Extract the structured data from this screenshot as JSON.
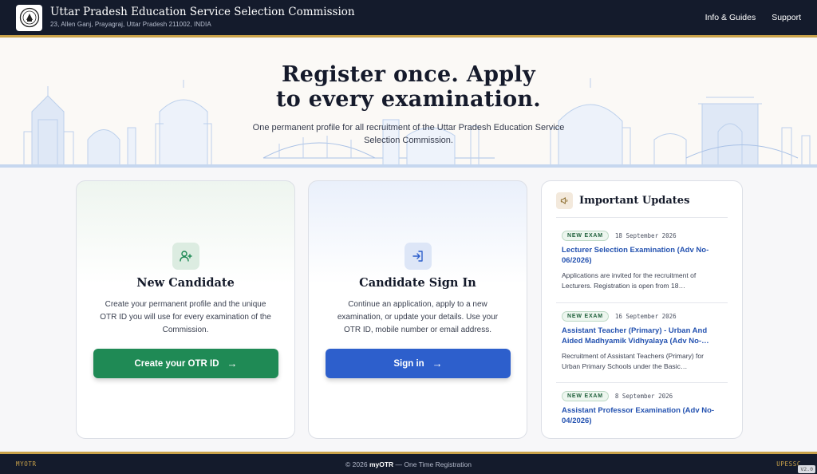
{
  "header": {
    "title": "Uttar Pradesh Education Service Selection Commission",
    "address": "23, Allen Ganj, Prayagraj, Uttar Pradesh 211002, INDIA",
    "nav": [
      "Info & Guides",
      "Support"
    ],
    "logo_icon": "emblem-icon"
  },
  "hero": {
    "title_line1": "Register once. Apply",
    "title_line2": "to every examination.",
    "subtitle": "One permanent profile for all recruitment of the Uttar Pradesh Education Service Selection Commission."
  },
  "new_candidate": {
    "icon": "user-plus-icon",
    "title": "New Candidate",
    "description": "Create your permanent profile and the unique OTR ID you will use for every examination of the Commission.",
    "button_label": "Create your OTR ID",
    "arrow": "→"
  },
  "sign_in": {
    "icon": "sign-in-icon",
    "title": "Candidate Sign In",
    "description": "Continue an application, apply to a new examination, or update your details. Use your OTR ID, mobile number or email address.",
    "button_label": "Sign in",
    "arrow": "→"
  },
  "updates": {
    "icon": "megaphone-icon",
    "title": "Important Updates",
    "items": [
      {
        "badge": "NEW EXAM",
        "date": "18 September 2026",
        "title": "Lecturer Selection Examination (Adv No-06/2026)",
        "desc": "Applications are invited for the recruitment of Lecturers. Registration is open from 18…"
      },
      {
        "badge": "NEW EXAM",
        "date": "16 September 2026",
        "title": "Assistant Teacher (Primary) - Urban And Aided Madhyamik Vidhyalaya (Adv No-…",
        "desc": "Recruitment of Assistant Teachers (Primary) for Urban Primary Schools under the Basic…"
      },
      {
        "badge": "NEW EXAM",
        "date": "8 September 2026",
        "title": "Assistant Professor Examination (Adv No-04/2026)",
        "desc": ""
      }
    ]
  },
  "footer": {
    "left": "MYOTR",
    "center_prefix": "© 2026",
    "center_brand": "myOTR",
    "center_suffix": "— One Time Registration",
    "right": "UPESSC",
    "version": "V2.0"
  },
  "colors": {
    "navy": "#141b2c",
    "gold": "#c9a24a",
    "green_button": "#1f8a55",
    "blue_button": "#2d5fcc",
    "link_blue": "#2452b0"
  }
}
